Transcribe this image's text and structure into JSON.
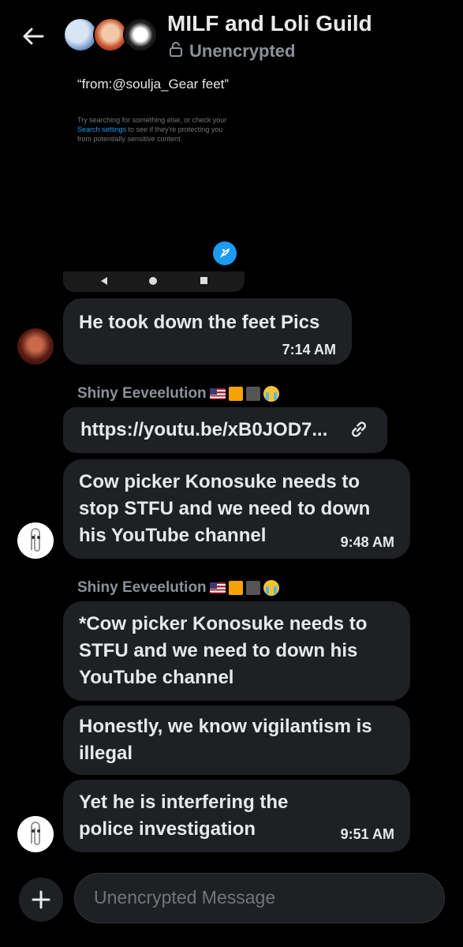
{
  "header": {
    "title": "MILF and Loli Guild",
    "subtitle": "Unencrypted"
  },
  "embed": {
    "query": "“from:@soulja_Gear feet”",
    "hint_before": "Try searching for something else, or check your ",
    "hint_link": "Search settings",
    "hint_after": " to see if they're protecting you from potentially sensitive content."
  },
  "messages": [
    {
      "text": "He took down the feet Pics",
      "time": "7:14 AM"
    },
    {
      "sender": "Shiny Eeveelution",
      "text": "https://youtu.be/xB0JOD7...",
      "is_link": true
    },
    {
      "text": "Cow picker Konosuke needs to stop STFU and we need to down his YouTube channel",
      "time": "9:48 AM"
    },
    {
      "sender": "Shiny Eeveelution",
      "text": "*Cow picker Konosuke needs to STFU and we need to down his YouTube channel"
    },
    {
      "text": "Honestly, we know vigilantism is illegal"
    },
    {
      "text": "Yet he is interfering the police investigation",
      "time": "9:51 AM"
    }
  ],
  "composer": {
    "placeholder": "Unencrypted Message"
  },
  "icons": {
    "back": "arrow-left-icon",
    "lock": "unlock-icon",
    "link": "link-icon",
    "plus": "plus-icon",
    "fab": "compose-icon"
  },
  "colors": {
    "background": "#000000",
    "bubble": "#1e2024",
    "accent": "#1d9bf0",
    "muted": "#8b9199"
  }
}
